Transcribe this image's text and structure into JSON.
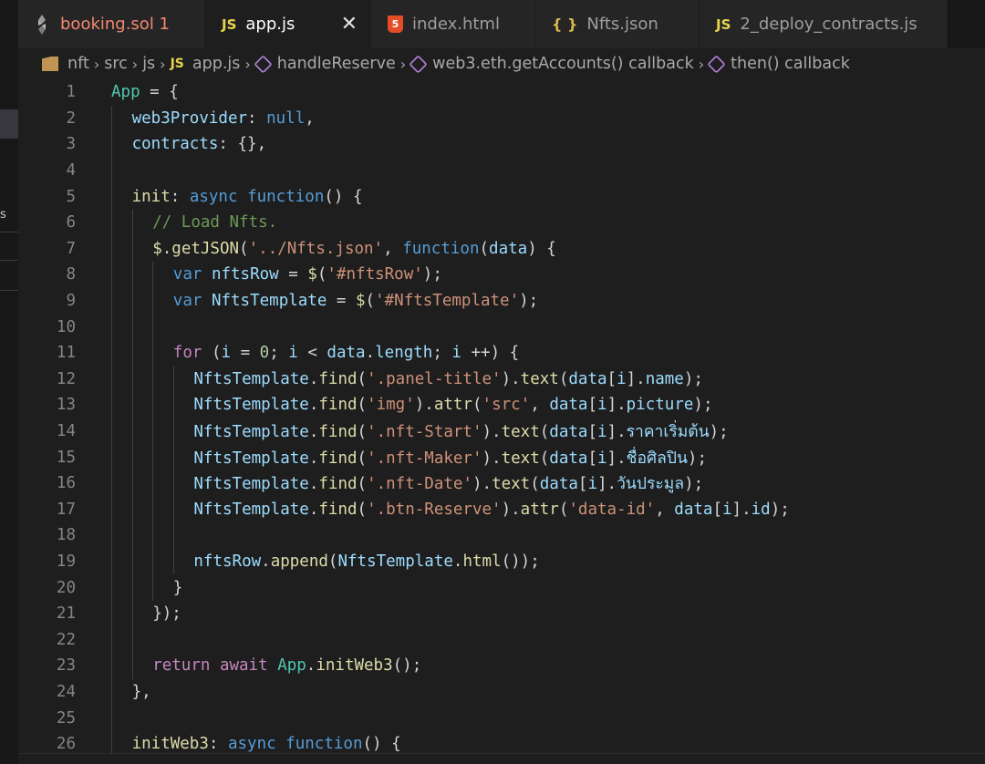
{
  "tabs": [
    {
      "icon": "solidity-icon",
      "label": "booking.sol 1",
      "active": false,
      "warn": true
    },
    {
      "icon": "js-icon",
      "icon_text": "JS",
      "label": "app.js",
      "active": true
    },
    {
      "icon": "html-icon",
      "icon_text": "5",
      "label": "index.html",
      "active": false
    },
    {
      "icon": "json-icon",
      "icon_text": "{ }",
      "label": "Nfts.json",
      "active": false
    },
    {
      "icon": "js-icon",
      "icon_text": "JS",
      "label": "2_deploy_contracts.js",
      "active": false
    }
  ],
  "close_glyph": "✕",
  "sidebar_fragment": "s",
  "breadcrumb": {
    "items": [
      "nft",
      "src",
      "js",
      "app.js",
      "handleReserve",
      "web3.eth.getAccounts() callback",
      "then() callback"
    ],
    "js_icon_text": "JS",
    "separator": "›"
  },
  "editor": {
    "language": "javascript",
    "lines": [
      {
        "n": "1",
        "indent": 0,
        "tokens": [
          [
            "t",
            "App"
          ],
          [
            "p",
            " = {"
          ]
        ]
      },
      {
        "n": "2",
        "indent": 1,
        "tokens": [
          [
            "v",
            "web3Provider"
          ],
          [
            "p",
            ": "
          ],
          [
            "k",
            "null"
          ],
          [
            "p",
            ","
          ]
        ]
      },
      {
        "n": "3",
        "indent": 1,
        "tokens": [
          [
            "v",
            "contracts"
          ],
          [
            "p",
            ": {},"
          ]
        ]
      },
      {
        "n": "4",
        "indent": 1,
        "tokens": []
      },
      {
        "n": "5",
        "indent": 1,
        "tokens": [
          [
            "f",
            "init"
          ],
          [
            "p",
            ": "
          ],
          [
            "k",
            "async"
          ],
          [
            "p",
            " "
          ],
          [
            "k",
            "function"
          ],
          [
            "p",
            "() {"
          ]
        ]
      },
      {
        "n": "6",
        "indent": 2,
        "tokens": [
          [
            "cm",
            "// Load Nfts."
          ]
        ]
      },
      {
        "n": "7",
        "indent": 2,
        "tokens": [
          [
            "f",
            "$"
          ],
          [
            "p",
            "."
          ],
          [
            "f",
            "getJSON"
          ],
          [
            "p",
            "("
          ],
          [
            "s",
            "'../Nfts.json'"
          ],
          [
            "p",
            ", "
          ],
          [
            "k",
            "function"
          ],
          [
            "p",
            "("
          ],
          [
            "v",
            "data"
          ],
          [
            "p",
            ") {"
          ]
        ]
      },
      {
        "n": "8",
        "indent": 3,
        "tokens": [
          [
            "k",
            "var"
          ],
          [
            "p",
            " "
          ],
          [
            "v",
            "nftsRow"
          ],
          [
            "p",
            " = "
          ],
          [
            "f",
            "$"
          ],
          [
            "p",
            "("
          ],
          [
            "s",
            "'#nftsRow'"
          ],
          [
            "p",
            ");"
          ]
        ]
      },
      {
        "n": "9",
        "indent": 3,
        "tokens": [
          [
            "k",
            "var"
          ],
          [
            "p",
            " "
          ],
          [
            "v",
            "NftsTemplate"
          ],
          [
            "p",
            " = "
          ],
          [
            "f",
            "$"
          ],
          [
            "p",
            "("
          ],
          [
            "s",
            "'#NftsTemplate'"
          ],
          [
            "p",
            ");"
          ]
        ]
      },
      {
        "n": "10",
        "indent": 3,
        "tokens": []
      },
      {
        "n": "11",
        "indent": 3,
        "tokens": [
          [
            "c",
            "for"
          ],
          [
            "p",
            " ("
          ],
          [
            "v",
            "i"
          ],
          [
            "p",
            " = "
          ],
          [
            "n",
            "0"
          ],
          [
            "p",
            "; "
          ],
          [
            "v",
            "i"
          ],
          [
            "p",
            " < "
          ],
          [
            "v",
            "data"
          ],
          [
            "p",
            "."
          ],
          [
            "v",
            "length"
          ],
          [
            "p",
            "; "
          ],
          [
            "v",
            "i"
          ],
          [
            "p",
            " ++) {"
          ]
        ]
      },
      {
        "n": "12",
        "indent": 4,
        "tokens": [
          [
            "v",
            "NftsTemplate"
          ],
          [
            "p",
            "."
          ],
          [
            "f",
            "find"
          ],
          [
            "p",
            "("
          ],
          [
            "s",
            "'.panel-title'"
          ],
          [
            "p",
            ")."
          ],
          [
            "f",
            "text"
          ],
          [
            "p",
            "("
          ],
          [
            "v",
            "data"
          ],
          [
            "p",
            "["
          ],
          [
            "v",
            "i"
          ],
          [
            "p",
            "]."
          ],
          [
            "v",
            "name"
          ],
          [
            "p",
            ");"
          ]
        ]
      },
      {
        "n": "13",
        "indent": 4,
        "tokens": [
          [
            "v",
            "NftsTemplate"
          ],
          [
            "p",
            "."
          ],
          [
            "f",
            "find"
          ],
          [
            "p",
            "("
          ],
          [
            "s",
            "'img'"
          ],
          [
            "p",
            ")."
          ],
          [
            "f",
            "attr"
          ],
          [
            "p",
            "("
          ],
          [
            "s",
            "'src'"
          ],
          [
            "p",
            ", "
          ],
          [
            "v",
            "data"
          ],
          [
            "p",
            "["
          ],
          [
            "v",
            "i"
          ],
          [
            "p",
            "]."
          ],
          [
            "v",
            "picture"
          ],
          [
            "p",
            ");"
          ]
        ]
      },
      {
        "n": "14",
        "indent": 4,
        "tokens": [
          [
            "v",
            "NftsTemplate"
          ],
          [
            "p",
            "."
          ],
          [
            "f",
            "find"
          ],
          [
            "p",
            "("
          ],
          [
            "s",
            "'.nft-Start'"
          ],
          [
            "p",
            ")."
          ],
          [
            "f",
            "text"
          ],
          [
            "p",
            "("
          ],
          [
            "v",
            "data"
          ],
          [
            "p",
            "["
          ],
          [
            "v",
            "i"
          ],
          [
            "p",
            "]."
          ],
          [
            "v",
            "ราคาเริ่มต้น"
          ],
          [
            "p",
            ");"
          ]
        ]
      },
      {
        "n": "15",
        "indent": 4,
        "tokens": [
          [
            "v",
            "NftsTemplate"
          ],
          [
            "p",
            "."
          ],
          [
            "f",
            "find"
          ],
          [
            "p",
            "("
          ],
          [
            "s",
            "'.nft-Maker'"
          ],
          [
            "p",
            ")."
          ],
          [
            "f",
            "text"
          ],
          [
            "p",
            "("
          ],
          [
            "v",
            "data"
          ],
          [
            "p",
            "["
          ],
          [
            "v",
            "i"
          ],
          [
            "p",
            "]."
          ],
          [
            "v",
            "ชื่อศิลปิน"
          ],
          [
            "p",
            ");"
          ]
        ]
      },
      {
        "n": "16",
        "indent": 4,
        "tokens": [
          [
            "v",
            "NftsTemplate"
          ],
          [
            "p",
            "."
          ],
          [
            "f",
            "find"
          ],
          [
            "p",
            "("
          ],
          [
            "s",
            "'.nft-Date'"
          ],
          [
            "p",
            ")."
          ],
          [
            "f",
            "text"
          ],
          [
            "p",
            "("
          ],
          [
            "v",
            "data"
          ],
          [
            "p",
            "["
          ],
          [
            "v",
            "i"
          ],
          [
            "p",
            "]."
          ],
          [
            "v",
            "วันประมูล"
          ],
          [
            "p",
            ");"
          ]
        ]
      },
      {
        "n": "17",
        "indent": 4,
        "tokens": [
          [
            "v",
            "NftsTemplate"
          ],
          [
            "p",
            "."
          ],
          [
            "f",
            "find"
          ],
          [
            "p",
            "("
          ],
          [
            "s",
            "'.btn-Reserve'"
          ],
          [
            "p",
            ")."
          ],
          [
            "f",
            "attr"
          ],
          [
            "p",
            "("
          ],
          [
            "s",
            "'data-id'"
          ],
          [
            "p",
            ", "
          ],
          [
            "v",
            "data"
          ],
          [
            "p",
            "["
          ],
          [
            "v",
            "i"
          ],
          [
            "p",
            "]."
          ],
          [
            "v",
            "id"
          ],
          [
            "p",
            ");"
          ]
        ]
      },
      {
        "n": "18",
        "indent": 4,
        "tokens": []
      },
      {
        "n": "19",
        "indent": 4,
        "tokens": [
          [
            "v",
            "nftsRow"
          ],
          [
            "p",
            "."
          ],
          [
            "f",
            "append"
          ],
          [
            "p",
            "("
          ],
          [
            "v",
            "NftsTemplate"
          ],
          [
            "p",
            "."
          ],
          [
            "f",
            "html"
          ],
          [
            "p",
            "());"
          ]
        ]
      },
      {
        "n": "20",
        "indent": 3,
        "tokens": [
          [
            "p",
            "}"
          ]
        ]
      },
      {
        "n": "21",
        "indent": 2,
        "tokens": [
          [
            "p",
            "});"
          ]
        ]
      },
      {
        "n": "22",
        "indent": 2,
        "tokens": []
      },
      {
        "n": "23",
        "indent": 2,
        "tokens": [
          [
            "c",
            "return"
          ],
          [
            "p",
            " "
          ],
          [
            "c",
            "await"
          ],
          [
            "p",
            " "
          ],
          [
            "t",
            "App"
          ],
          [
            "p",
            "."
          ],
          [
            "f",
            "initWeb3"
          ],
          [
            "p",
            "();"
          ]
        ]
      },
      {
        "n": "24",
        "indent": 1,
        "tokens": [
          [
            "p",
            "},"
          ]
        ]
      },
      {
        "n": "25",
        "indent": 1,
        "tokens": []
      },
      {
        "n": "26",
        "indent": 1,
        "tokens": [
          [
            "f",
            "initWeb3"
          ],
          [
            "p",
            ": "
          ],
          [
            "k",
            "async"
          ],
          [
            "p",
            " "
          ],
          [
            "k",
            "function"
          ],
          [
            "p",
            "() {"
          ]
        ]
      }
    ]
  },
  "colors": {
    "background": "#1e1e1e",
    "tab_inactive": "#252526",
    "keyword": "#569cd6",
    "control": "#c586c0",
    "variable": "#9cdcfe",
    "function": "#dcdcaa",
    "string": "#ce9178",
    "number": "#b5cea8",
    "comment": "#6a9955",
    "type": "#4ec9b0"
  }
}
